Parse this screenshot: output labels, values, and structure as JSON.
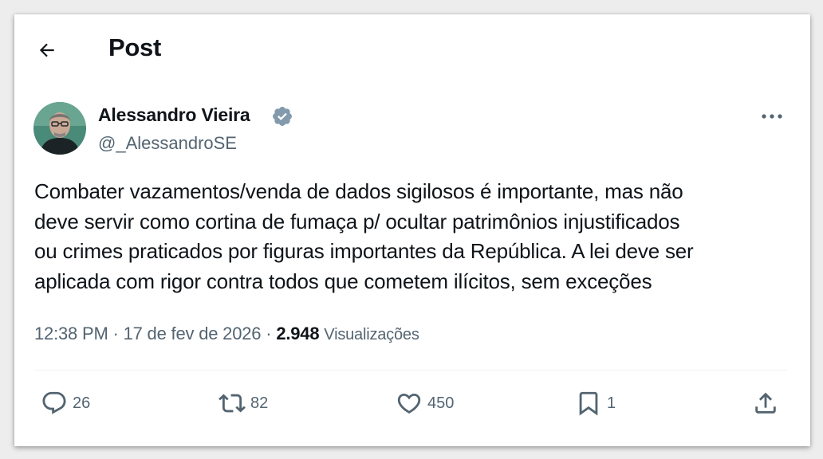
{
  "header": {
    "title": "Post"
  },
  "author": {
    "name": "Alessandro Vieira",
    "handle": "@_AlessandroSE"
  },
  "tweet": {
    "lines": [
      "Combater vazamentos/venda de dados sigilosos é importante, mas não",
      "deve servir como cortina de fumaça p/ ocultar patrimônios injustificados",
      "ou crimes praticados por figuras importantes da República. A lei deve ser",
      "aplicada com rigor contra todos que cometem ilícitos, sem exceções"
    ],
    "time": "12:38 PM",
    "date": "17 de fev de 2026",
    "separator": "·",
    "views_count": "2.948",
    "views_label": "Visualizações"
  },
  "actions": {
    "replies": "26",
    "reposts": "82",
    "likes": "450",
    "bookmarks": "1"
  },
  "icons": {
    "back": "arrow-left-icon",
    "verified": "verified-badge-icon",
    "more": "ellipsis-icon",
    "reply": "speech-bubble-icon",
    "repost": "repost-arrows-icon",
    "like": "heart-icon",
    "bookmark": "bookmark-icon",
    "share": "share-upload-icon"
  },
  "colors": {
    "text": "#0f1419",
    "secondary": "#536471",
    "verified_badge": "#829aab",
    "divider": "#eff3f4"
  }
}
